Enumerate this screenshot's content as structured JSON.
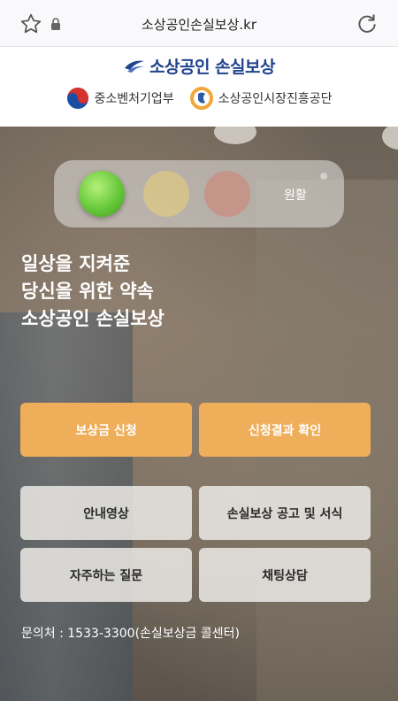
{
  "browser": {
    "url": "소상공인손실보상.kr"
  },
  "site": {
    "title": "소상공인 손실보상",
    "partners": [
      {
        "name": "중소벤처기업부"
      },
      {
        "name": "소상공인시장진흥공단"
      }
    ]
  },
  "hero": {
    "traffic_status": "원활",
    "slogan_lines": [
      "일상을 지켜준",
      "당신을 위한 약속",
      "소상공인 손실보상"
    ]
  },
  "buttons": {
    "apply": "보상금 신청",
    "check_result": "신청결과 확인",
    "guide_video": "안내영상",
    "notice_forms": "손실보상 공고 및 서식",
    "faq": "자주하는 질문",
    "chat": "채팅상담"
  },
  "contact": "문의처 : 1533-3300(손실보상금 콜센터)",
  "colors": {
    "primary_button": "#eeae5a",
    "brand_navy": "#22438e",
    "traffic_green": "#67c83b"
  },
  "icons": {
    "bookmark": "star-icon",
    "secure": "lock-icon",
    "reload": "reload-icon"
  }
}
